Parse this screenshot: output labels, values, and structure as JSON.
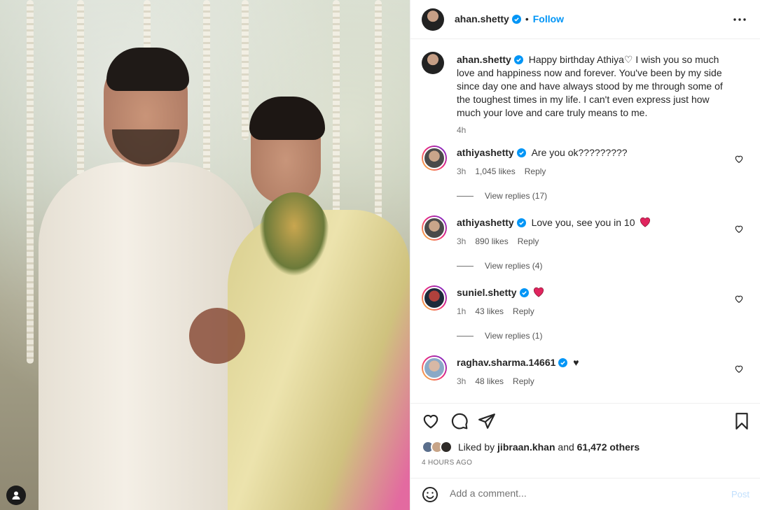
{
  "header": {
    "username": "ahan.shetty",
    "separator": "•",
    "follow_label": "Follow",
    "more_icon": "more-horizontal-icon"
  },
  "caption": {
    "username": "ahan.shetty",
    "text": "Happy birthday Athiya♡ I wish you so much love and happiness now and forever. You've been by my side since day one and have always stood by me through some of the toughest times in my life. I can't even express just how much your love and care truly means to me.",
    "time": "4h"
  },
  "comments": [
    {
      "username": "athiyashetty",
      "text": "Are you ok?????????",
      "time": "3h",
      "likes": "1,045 likes",
      "reply": "Reply",
      "view_replies": "View replies (17)",
      "avatar_color": "#c9a58a"
    },
    {
      "username": "athiyashetty",
      "text": "Love you, see you in 10",
      "time": "3h",
      "likes": "890 likes",
      "reply": "Reply",
      "view_replies": "View replies (4)",
      "avatar_color": "#c9a58a"
    },
    {
      "username": "suniel.shetty",
      "text": "",
      "time": "1h",
      "likes": "43 likes",
      "reply": "Reply",
      "view_replies": "View replies (1)",
      "avatar_color": "#3b3b3b"
    },
    {
      "username": "raghav.sharma.14661",
      "text": "♥",
      "time": "3h",
      "likes": "48 likes",
      "reply": "Reply",
      "view_replies": "",
      "avatar_color": "#d7b8a5"
    }
  ],
  "likes": {
    "prefix": "Liked by",
    "user": "jibraan.khan",
    "middle": "and",
    "count": "61,472 others"
  },
  "posted": "4 HOURS AGO",
  "comment_box": {
    "placeholder": "Add a comment...",
    "post_label": "Post"
  },
  "colors": {
    "accent": "#0095f6",
    "heart_red": "#e0245e",
    "muted": "#737373"
  }
}
